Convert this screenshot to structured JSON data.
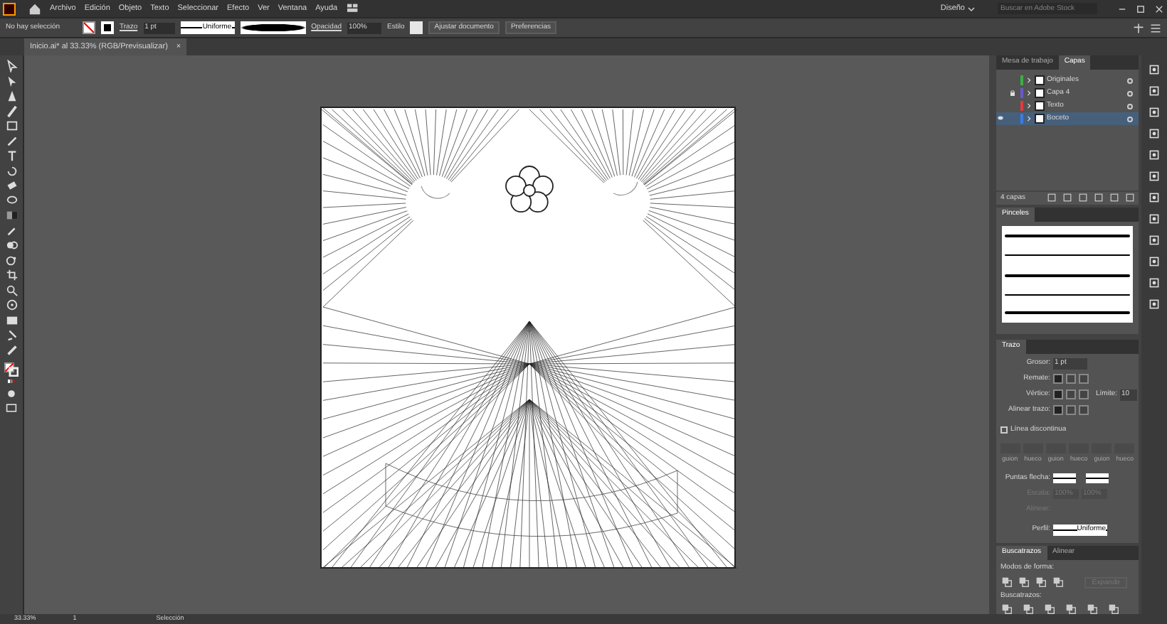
{
  "menu": [
    "Archivo",
    "Edición",
    "Objeto",
    "Texto",
    "Seleccionar",
    "Efecto",
    "Ver",
    "Ventana",
    "Ayuda"
  ],
  "workspace": "Diseño",
  "search": {
    "placeholder": "Buscar en Adobe Stock"
  },
  "control_bar": {
    "selection": "No hay selección",
    "stroke_label": "Trazo",
    "stroke_weight": "1 pt",
    "profile": "Uniforme",
    "opacity_label": "Opacidad",
    "opacity": "100%",
    "style_label": "Estilo",
    "buttons": [
      "Ajustar documento",
      "Preferencias"
    ]
  },
  "document_tab": {
    "title": "Inicio.ai* al 33.33% (RGB/Previsualizar)",
    "close": "×"
  },
  "layers_panel": {
    "tabs": [
      {
        "label": "Mesa de trabajo",
        "selected": false
      },
      {
        "label": "Capas",
        "selected": true
      }
    ],
    "layers": [
      {
        "name": "Originales",
        "color": "#3cb043",
        "visible": false,
        "locked": false,
        "selected": false
      },
      {
        "name": "Capa 4",
        "color": "#6a5acd",
        "visible": false,
        "locked": true,
        "selected": false
      },
      {
        "name": "Texto",
        "color": "#e03c3c",
        "visible": false,
        "locked": false,
        "selected": false
      },
      {
        "name": "Boceto",
        "color": "#3c7be0",
        "visible": true,
        "locked": false,
        "selected": true
      }
    ],
    "count": "4 capas"
  },
  "brushes_panel": {
    "title": "Pinceles"
  },
  "stroke_panel": {
    "title": "Trazo",
    "weight_label": "Grosor:",
    "weight": "1 pt",
    "cap_label": "Remate:",
    "corner_label": "Vértice:",
    "limit_label": "Límite:",
    "limit": "10",
    "align_label": "Alinear trazo:",
    "dashed": {
      "label": "Línea discontinua",
      "checked": false
    },
    "dash_fields": [
      "guion",
      "hueco",
      "guion",
      "hueco",
      "guion",
      "hueco"
    ],
    "cap_options": [
      {
        "selected": true
      },
      {
        "selected": false
      },
      {
        "selected": false
      }
    ],
    "corner_options": [
      {
        "selected": true
      },
      {
        "selected": false
      },
      {
        "selected": false
      }
    ],
    "align_options": [
      {
        "selected": true
      },
      {
        "selected": false
      },
      {
        "selected": false
      }
    ],
    "arrow_label": "Puntas flecha:",
    "scale_label": "Escala:",
    "scale_values": [
      "100%",
      "100%"
    ],
    "arrow_align_label": "Alinear:",
    "profile_label": "Perfil:",
    "profile": "Uniforme"
  },
  "pathfinder_panel": {
    "tabs": [
      {
        "label": "Buscatrazos",
        "selected": true
      },
      {
        "label": "Alinear",
        "selected": false
      }
    ],
    "shape_modes_label": "Modos de forma:",
    "expand_button": {
      "label": "Expandir",
      "disabled": true
    },
    "pathfinders_label": "Buscatrazos:"
  },
  "status_bar": {
    "zoom": "33.33%",
    "artboard": "1",
    "tool": "Selección"
  }
}
